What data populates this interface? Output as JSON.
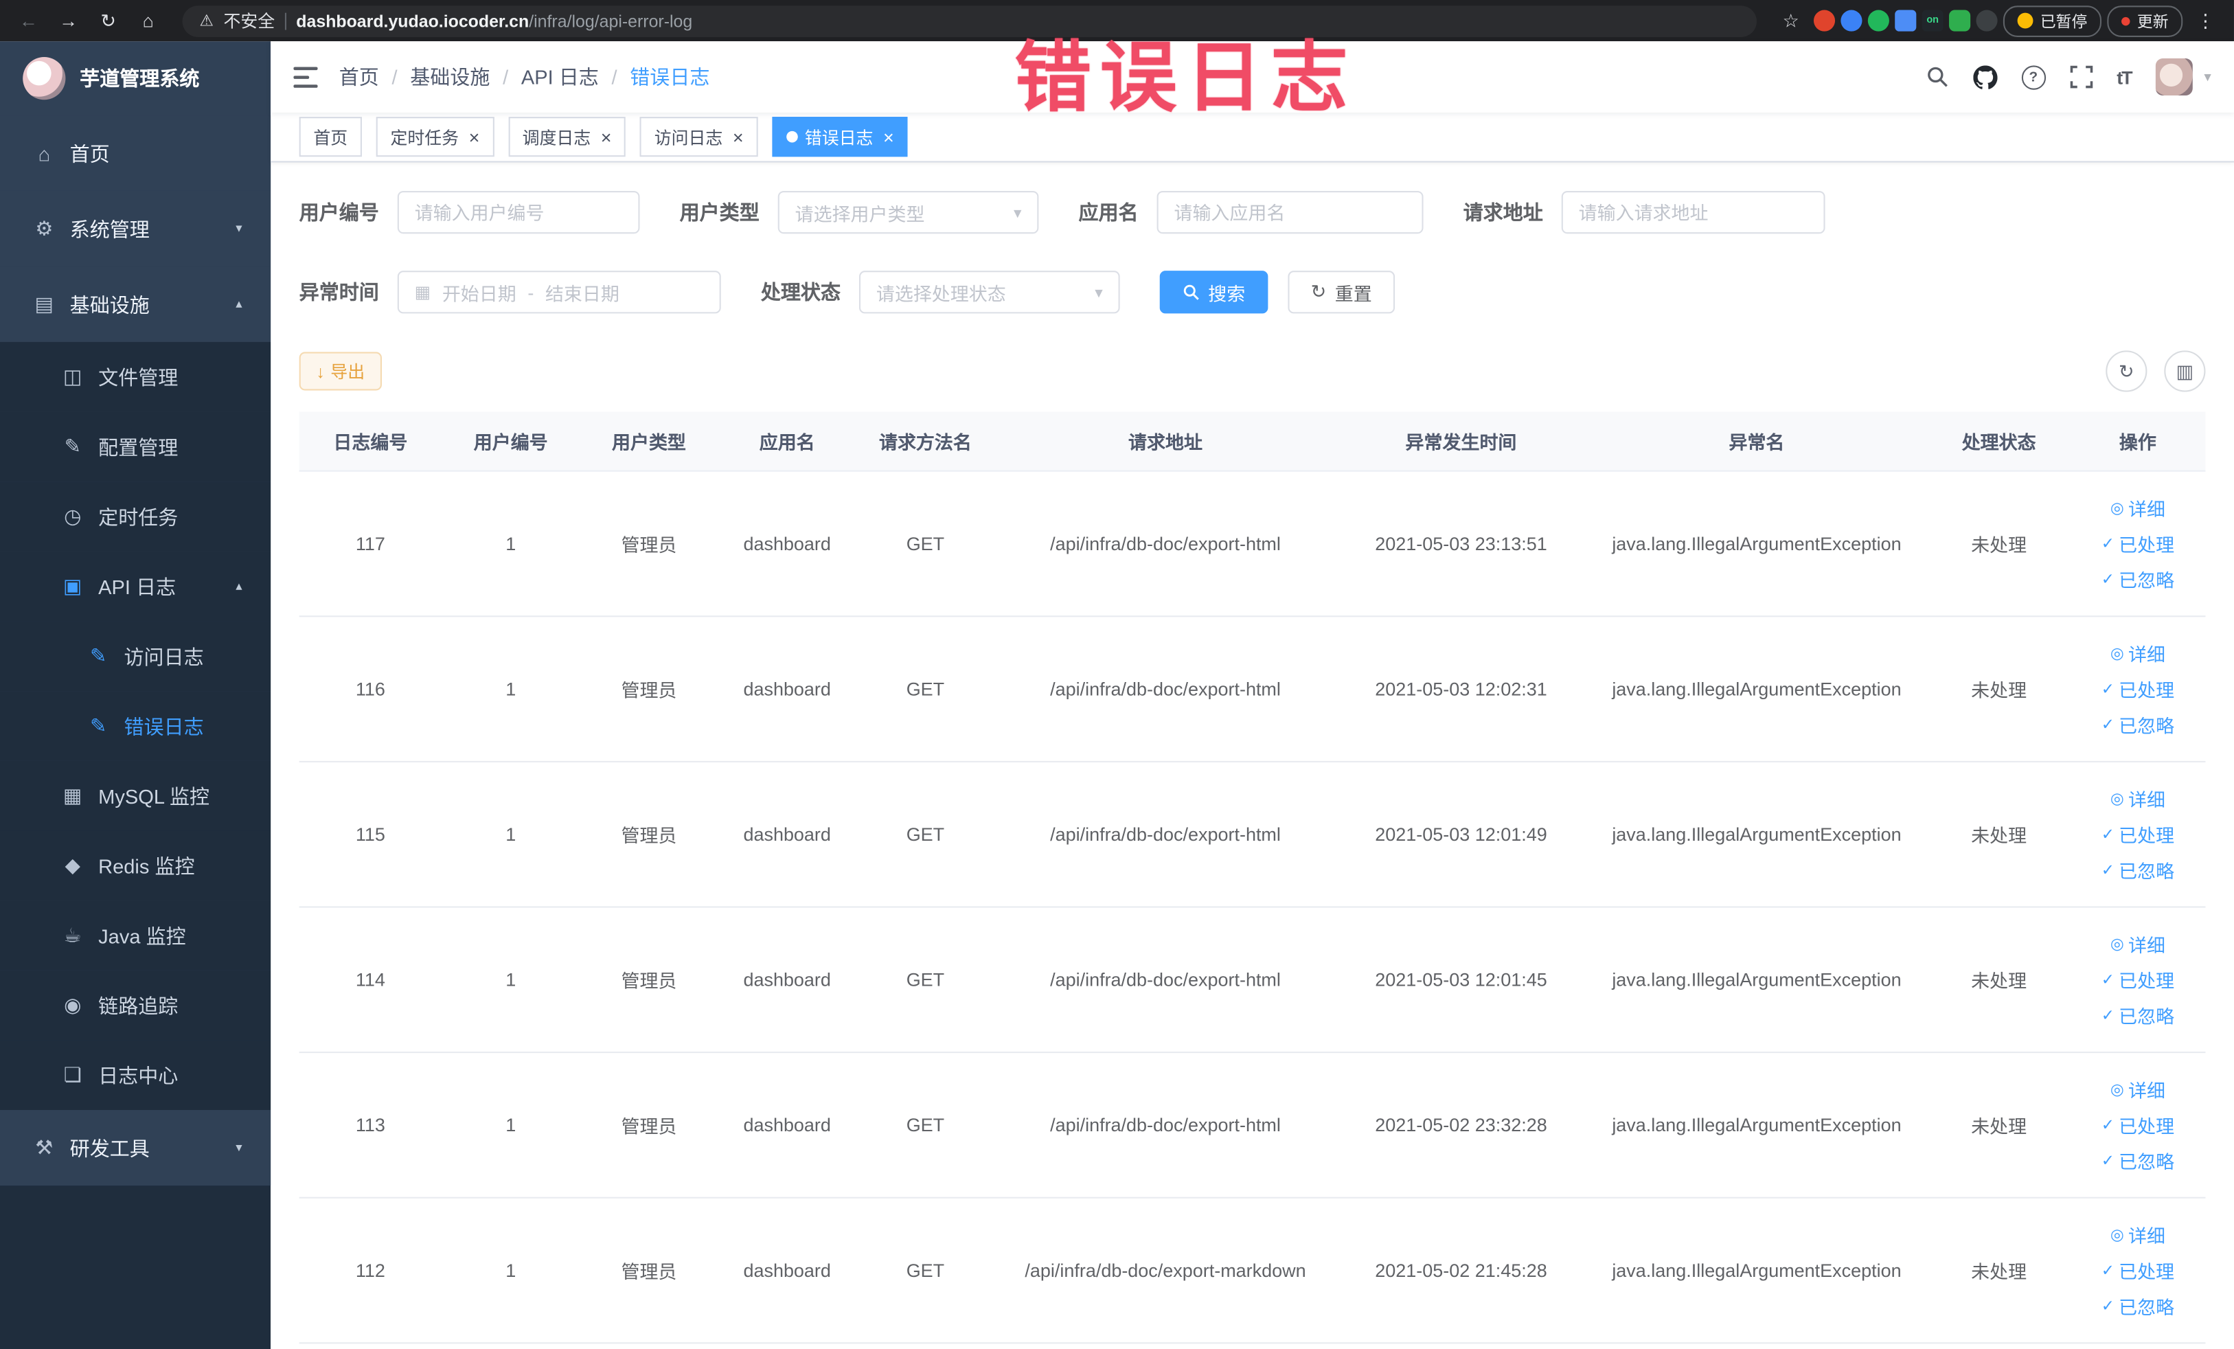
{
  "browser": {
    "security_label": "不安全",
    "url_host": "dashboard.yudao.iocoder.cn",
    "url_path": "/infra/log/api-error-log",
    "paused_badge": "已暂停",
    "update_label": "更新"
  },
  "annotation": {
    "text": "错误日志"
  },
  "sidebar": {
    "logo_title": "芋道管理系统",
    "items": [
      {
        "label": "首页",
        "icon": "home-icon",
        "level": 1
      },
      {
        "label": "系统管理",
        "icon": "system-gear-icon",
        "level": 1,
        "arrow": "down"
      },
      {
        "label": "基础设施",
        "icon": "infrastructure-icon",
        "level": 1,
        "arrow": "up"
      },
      {
        "label": "文件管理",
        "icon": "file-manage-icon",
        "level": 2
      },
      {
        "label": "配置管理",
        "icon": "config-manage-icon",
        "level": 2
      },
      {
        "label": "定时任务",
        "icon": "scheduled-task-icon",
        "level": 2
      },
      {
        "label": "API 日志",
        "icon": "api-log-icon",
        "level": 2,
        "arrow": "up"
      },
      {
        "label": "访问日志",
        "icon": "access-log-icon",
        "level": 3
      },
      {
        "label": "错误日志",
        "icon": "error-log-icon",
        "level": 3,
        "active": true
      },
      {
        "label": "MySQL 监控",
        "icon": "mysql-monitor-icon",
        "level": 2
      },
      {
        "label": "Redis 监控",
        "icon": "redis-monitor-icon",
        "level": 2
      },
      {
        "label": "Java 监控",
        "icon": "java-monitor-icon",
        "level": 2
      },
      {
        "label": "链路追踪",
        "icon": "trace-icon",
        "level": 2
      },
      {
        "label": "日志中心",
        "icon": "log-center-icon",
        "level": 2
      },
      {
        "label": "研发工具",
        "icon": "devtools-icon",
        "level": 1,
        "arrow": "down"
      }
    ]
  },
  "navbar": {
    "breadcrumb": [
      "首页",
      "基础设施",
      "API 日志",
      "错误日志"
    ]
  },
  "tabs": [
    {
      "label": "首页",
      "closable": false,
      "active": false
    },
    {
      "label": "定时任务",
      "closable": true,
      "active": false
    },
    {
      "label": "调度日志",
      "closable": true,
      "active": false
    },
    {
      "label": "访问日志",
      "closable": true,
      "active": false
    },
    {
      "label": "错误日志",
      "closable": true,
      "active": true
    }
  ],
  "filters": {
    "user_id": {
      "label": "用户编号",
      "placeholder": "请输入用户编号"
    },
    "user_type": {
      "label": "用户类型",
      "placeholder": "请选择用户类型"
    },
    "app_name": {
      "label": "应用名",
      "placeholder": "请输入应用名"
    },
    "request_url": {
      "label": "请求地址",
      "placeholder": "请输入请求地址"
    },
    "exception_time": {
      "label": "异常时间",
      "start_placeholder": "开始日期",
      "separator": "-",
      "end_placeholder": "结束日期"
    },
    "process_status": {
      "label": "处理状态",
      "placeholder": "请选择处理状态"
    },
    "search_label": "搜索",
    "reset_label": "重置"
  },
  "toolbar": {
    "export_label": "导出"
  },
  "table": {
    "columns": [
      "日志编号",
      "用户编号",
      "用户类型",
      "应用名",
      "请求方法名",
      "请求地址",
      "异常发生时间",
      "异常名",
      "处理状态",
      "操作"
    ],
    "rows": [
      [
        "117",
        "1",
        "管理员",
        "dashboard",
        "GET",
        "/api/infra/db-doc/export-html",
        "2021-05-03 23:13:51",
        "java.lang.IllegalArgumentException",
        "未处理"
      ],
      [
        "116",
        "1",
        "管理员",
        "dashboard",
        "GET",
        "/api/infra/db-doc/export-html",
        "2021-05-03 12:02:31",
        "java.lang.IllegalArgumentException",
        "未处理"
      ],
      [
        "115",
        "1",
        "管理员",
        "dashboard",
        "GET",
        "/api/infra/db-doc/export-html",
        "2021-05-03 12:01:49",
        "java.lang.IllegalArgumentException",
        "未处理"
      ],
      [
        "114",
        "1",
        "管理员",
        "dashboard",
        "GET",
        "/api/infra/db-doc/export-html",
        "2021-05-03 12:01:45",
        "java.lang.IllegalArgumentException",
        "未处理"
      ],
      [
        "113",
        "1",
        "管理员",
        "dashboard",
        "GET",
        "/api/infra/db-doc/export-html",
        "2021-05-02 23:32:28",
        "java.lang.IllegalArgumentException",
        "未处理"
      ],
      [
        "112",
        "1",
        "管理员",
        "dashboard",
        "GET",
        "/api/infra/db-doc/export-markdown",
        "2021-05-02 21:45:28",
        "java.lang.IllegalArgumentException",
        "未处理"
      ]
    ],
    "actions": [
      "详细",
      "已处理",
      "已忽略"
    ]
  },
  "colors": {
    "primary": "#409eff",
    "sidebar_bg": "#304156",
    "sidebar_sub_bg": "#1f2d3d",
    "warning": "#e6a23c",
    "annotation": "#f04c66"
  }
}
